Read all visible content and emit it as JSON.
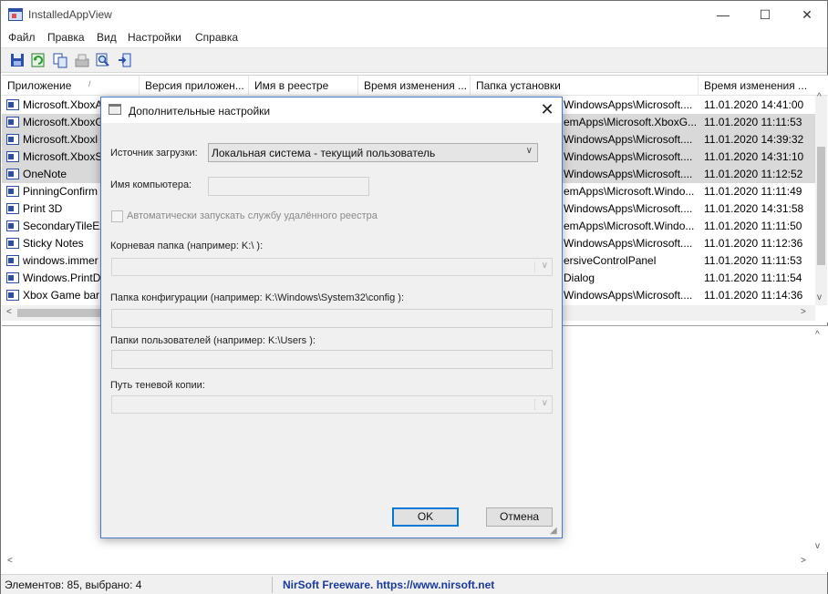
{
  "window": {
    "title": "InstalledAppView",
    "min_glyph": "—",
    "max_glyph": "☐",
    "close_glyph": "✕"
  },
  "menu": [
    "Файл",
    "Правка",
    "Вид",
    "Настройки",
    "Справка"
  ],
  "toolbar_icons": [
    "save-icon",
    "refresh-icon",
    "copy-icon",
    "properties-icon",
    "find-icon",
    "exit-icon"
  ],
  "list": {
    "columns": [
      "Приложение",
      "Версия приложен...",
      "Имя в реестре",
      "Время изменения ...",
      "Папка установки",
      "Время изменения ..."
    ],
    "sort_glyph": "/",
    "rows": [
      {
        "app": "Microsoft.XboxA",
        "folder": "WindowsApps\\Microsoft....",
        "time": "11.01.2020 14:41:00",
        "selected": false
      },
      {
        "app": "Microsoft.XboxG",
        "folder": "emApps\\Microsoft.XboxG...",
        "time": "11.01.2020 11:11:53",
        "selected": true
      },
      {
        "app": "Microsoft.Xboxl",
        "folder": "WindowsApps\\Microsoft....",
        "time": "11.01.2020 14:39:32",
        "selected": true
      },
      {
        "app": "Microsoft.XboxS",
        "folder": "WindowsApps\\Microsoft....",
        "time": "11.01.2020 14:31:10",
        "selected": true
      },
      {
        "app": "OneNote",
        "folder": "WindowsApps\\Microsoft....",
        "time": "11.01.2020 11:12:52",
        "selected": true
      },
      {
        "app": "PinningConfirm",
        "folder": "emApps\\Microsoft.Windo...",
        "time": "11.01.2020 11:11:49",
        "selected": false
      },
      {
        "app": "Print 3D",
        "folder": "WindowsApps\\Microsoft....",
        "time": "11.01.2020 14:31:58",
        "selected": false
      },
      {
        "app": "SecondaryTileEx",
        "folder": "emApps\\Microsoft.Windo...",
        "time": "11.01.2020 11:11:50",
        "selected": false
      },
      {
        "app": "Sticky Notes",
        "folder": "WindowsApps\\Microsoft....",
        "time": "11.01.2020 11:12:36",
        "selected": false
      },
      {
        "app": "windows.immer",
        "folder": "ersiveControlPanel",
        "time": "11.01.2020 11:11:53",
        "selected": false
      },
      {
        "app": "Windows.PrintD",
        "folder": "Dialog",
        "time": "11.01.2020 11:11:54",
        "selected": false
      },
      {
        "app": "Xbox Game bar",
        "folder": "WindowsApps\\Microsoft....",
        "time": "11.01.2020 11:14:36",
        "selected": false
      }
    ]
  },
  "scroll": {
    "up": "^",
    "down": "v",
    "left": "<",
    "right": ">"
  },
  "status": {
    "count": "Элементов: 85, выбрано: 4",
    "link": "NirSoft Freeware. https://www.nirsoft.net"
  },
  "dialog": {
    "title": "Дополнительные настройки",
    "close_glyph": "✕",
    "source_label": "Источник загрузки:",
    "source_value": "Локальная система - текущий пользователь",
    "computer_label": "Имя компьютера:",
    "auto_start_label": "Автоматически запускать службу удалённого реестра",
    "root_label": "Корневая папка (например: K:\\ ):",
    "config_label": "Папка конфигурации (например: K:\\Windows\\System32\\config ):",
    "users_label": "Папки пользователей (например: K:\\Users ):",
    "shadow_label": "Путь теневой копии:",
    "ok": "OK",
    "cancel": "Отмена",
    "chevron_glyph": "∨",
    "grip_glyph": "◢"
  }
}
